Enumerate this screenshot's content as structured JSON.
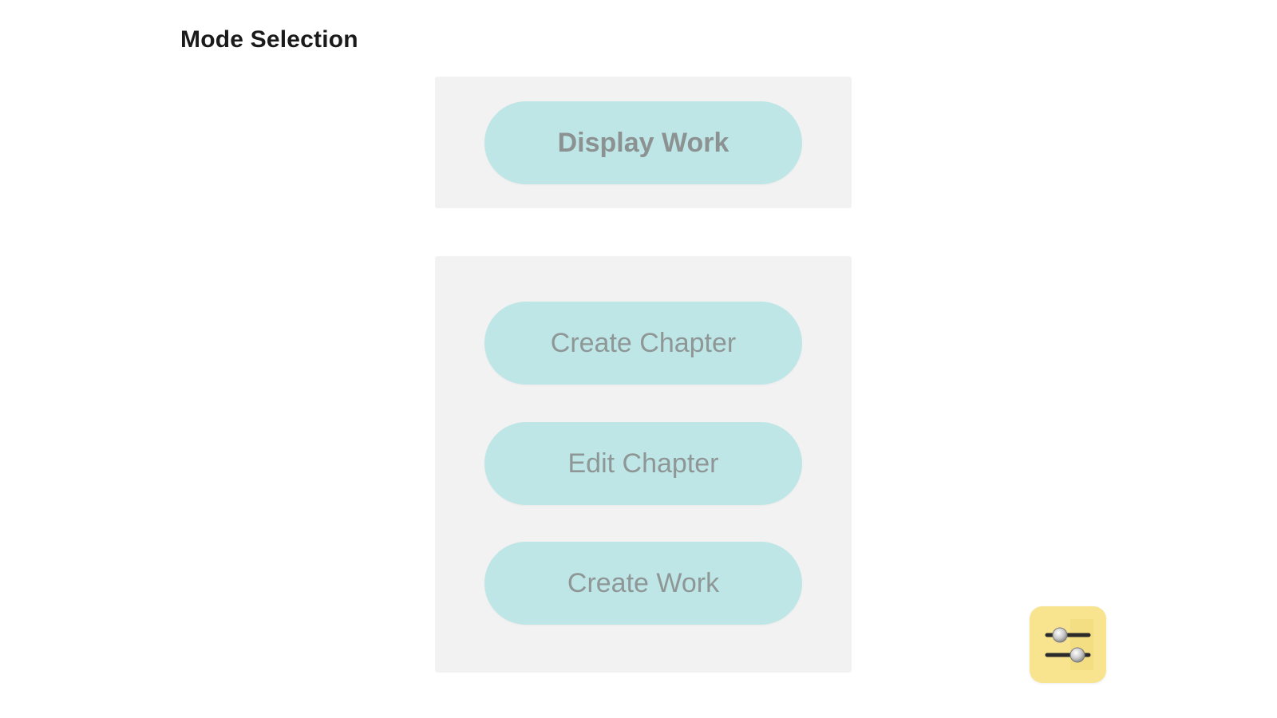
{
  "header": {
    "title": "Mode Selection"
  },
  "display_panel": {
    "buttons": [
      {
        "label": "Display Work"
      }
    ]
  },
  "edit_panel": {
    "buttons": [
      {
        "label": "Create Chapter"
      },
      {
        "label": "Edit Chapter"
      },
      {
        "label": "Create Work"
      }
    ]
  },
  "settings": {
    "icon": "sliders-icon",
    "background": "#f8e48f"
  },
  "colors": {
    "button_background": "#bfe6e6",
    "button_text": "#8f9696",
    "panel_background": "#f2f2f2"
  }
}
